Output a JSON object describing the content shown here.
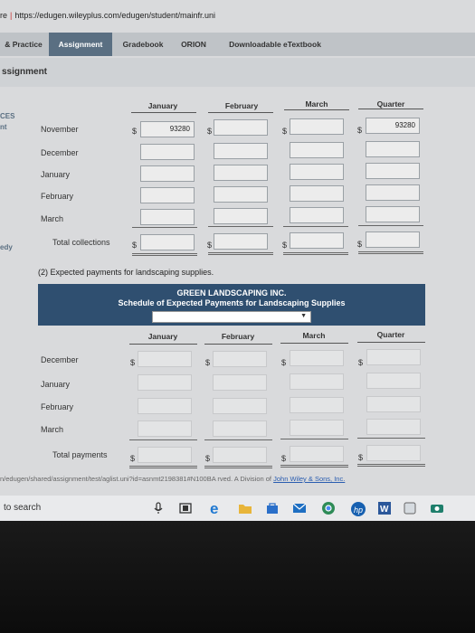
{
  "browser": {
    "prefix": "re",
    "url": "https://edugen.wileyplus.com/edugen/student/mainfr.uni"
  },
  "tabs": [
    "& Practice",
    "Assignment",
    "Gradebook",
    "ORION",
    "Downloadable eTextbook"
  ],
  "page_title": "ssignment",
  "edge_labels": [
    "CES",
    "nt",
    "edy"
  ],
  "schedule1": {
    "headers": [
      "January",
      "February",
      "March",
      "Quarter"
    ],
    "rows": [
      "November",
      "December",
      "January",
      "February",
      "March"
    ],
    "november_january_value": "93280",
    "november_quarter_value": "93280",
    "total_label": "Total collections",
    "currency": "$"
  },
  "section2_heading": "(2) Expected payments for landscaping supplies.",
  "schedule2": {
    "company": "GREEN LANDSCAPING INC.",
    "title": "Schedule of Expected Payments for Landscaping Supplies",
    "headers": [
      "January",
      "February",
      "March",
      "Quarter"
    ],
    "rows": [
      "December",
      "January",
      "February",
      "March"
    ],
    "total_label": "Total payments",
    "currency": "$"
  },
  "footer": {
    "path": "n/edugen/shared/assignment/test/aglist.uni?id=asnmt2198381#N100BA",
    "rights": "rved. A Division of",
    "link": "John Wiley & Sons, Inc."
  },
  "taskbar": {
    "search_text": "to search"
  }
}
